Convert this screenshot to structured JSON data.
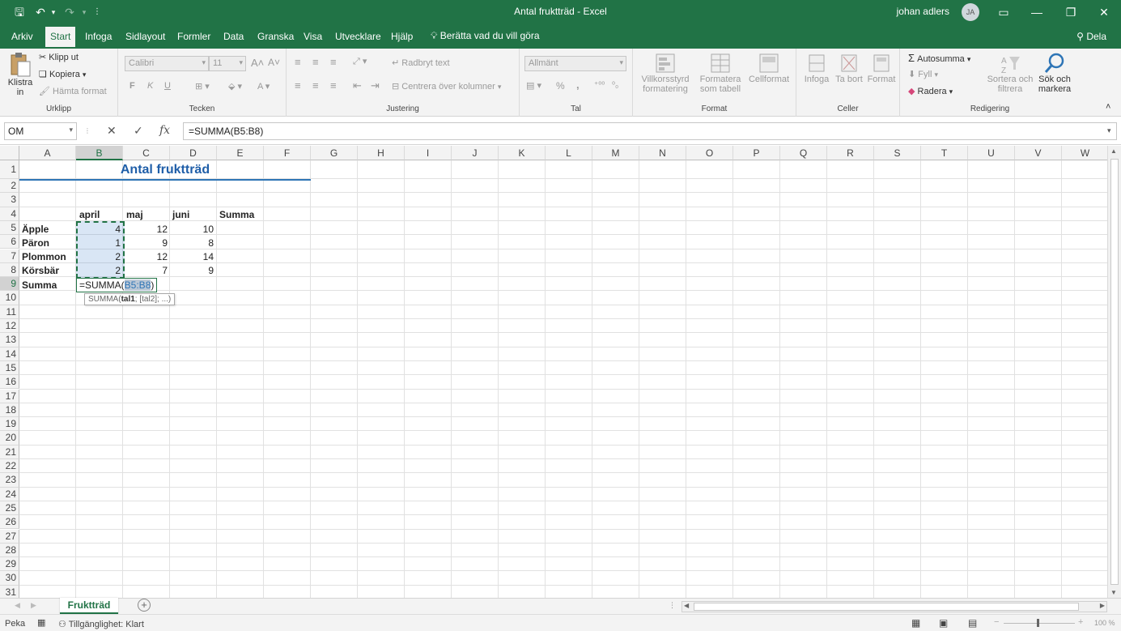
{
  "titlebar": {
    "title": "Antal fruktträd  -  Excel",
    "user": "johan adlers",
    "avatar_initials": "JA"
  },
  "tabs": [
    "Arkiv",
    "Start",
    "Infoga",
    "Sidlayout",
    "Formler",
    "Data",
    "Granska",
    "Visa",
    "Utvecklare",
    "Hjälp"
  ],
  "active_tab": "Start",
  "tell_me": "Berätta vad du vill göra",
  "share": "Dela",
  "ribbon": {
    "clipboard": {
      "paste": "Klistra",
      "paste2": "in",
      "cut": "Klipp ut",
      "copy": "Kopiera",
      "format_painter": "Hämta format",
      "label": "Urklipp"
    },
    "font": {
      "name": "Calibri",
      "size": "11",
      "bold": "F",
      "italic": "K",
      "underline": "U",
      "label": "Tecken"
    },
    "alignment": {
      "wrap": "Radbryt text",
      "merge": "Centrera över kolumner",
      "label": "Justering"
    },
    "number": {
      "format": "Allmänt",
      "percent": "%",
      "comma": ",",
      "label": "Tal"
    },
    "styles": {
      "conditional": "Villkorsstyrd",
      "conditional2": "formatering",
      "as_table": "Formatera",
      "as_table2": "som tabell",
      "cell_styles": "Cellformat",
      "label": "Format"
    },
    "cells": {
      "insert": "Infoga",
      "delete": "Ta bort",
      "format": "Format",
      "label": "Celler"
    },
    "editing": {
      "autosum": "Autosumma",
      "fill": "Fyll",
      "clear": "Radera",
      "sort": "Sortera och",
      "sort2": "filtrera",
      "find": "Sök och",
      "find2": "markera",
      "label": "Redigering"
    }
  },
  "formula_bar": {
    "name_box": "OM",
    "fx": "fx",
    "formula": "=SUMMA(B5:B8)"
  },
  "columns": [
    "A",
    "B",
    "C",
    "D",
    "E",
    "F",
    "G",
    "H",
    "I",
    "J",
    "K",
    "L",
    "M",
    "N",
    "O",
    "P",
    "Q",
    "R",
    "S",
    "T",
    "U",
    "V",
    "W"
  ],
  "rows": [
    "1",
    "2",
    "3",
    "4",
    "5",
    "6",
    "7",
    "8",
    "9",
    "10",
    "11",
    "12",
    "13",
    "14",
    "15",
    "16",
    "17",
    "18",
    "19",
    "20",
    "21",
    "22",
    "23",
    "24",
    "25",
    "26",
    "27",
    "28",
    "29",
    "30",
    "31"
  ],
  "sheet": {
    "title": "Antal fruktträd",
    "headers": [
      "april",
      "maj",
      "juni",
      "Summa"
    ],
    "data_rows": [
      {
        "label": "Äpple",
        "values": [
          "4",
          "12",
          "10"
        ]
      },
      {
        "label": "Päron",
        "values": [
          "1",
          "9",
          "8"
        ]
      },
      {
        "label": "Plommon",
        "values": [
          "2",
          "12",
          "14"
        ]
      },
      {
        "label": "Körsbär",
        "values": [
          "2",
          "7",
          "9"
        ]
      }
    ],
    "sum_label": "Summa",
    "edit_prefix": "=SUMMA(",
    "edit_ref": "B5:B8",
    "edit_suffix": ")",
    "tooltip_pre": "SUMMA(",
    "tooltip_bold": "tal1",
    "tooltip_post": "; [tal2]; ...)"
  },
  "sheet_tab": "Fruktträd",
  "status": {
    "mode": "Peka",
    "accessibility": "Tillgänglighet: Klart",
    "zoom": "100 %"
  }
}
